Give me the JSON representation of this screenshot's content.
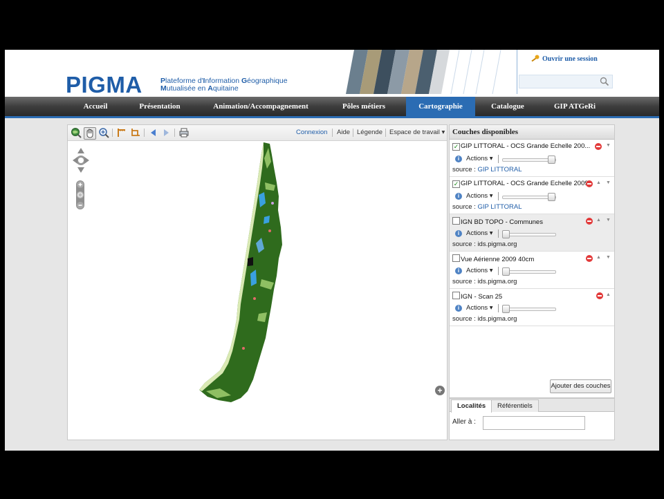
{
  "header": {
    "logo": "PIGMA",
    "tagline_line1": {
      "p": "P",
      "rest1": "lateforme d'",
      "i": "I",
      "rest2": "nformation ",
      "g": "G",
      "rest3": "éographique"
    },
    "tagline_line2": {
      "m": "M",
      "rest1": "utualisée en ",
      "a": "A",
      "rest2": "quitaine"
    },
    "session_label": "Ouvrir une session",
    "search_placeholder": ""
  },
  "nav": {
    "items": [
      {
        "label": "Accueil"
      },
      {
        "label": "Présentation"
      },
      {
        "label": "Animation/Accompagnement"
      },
      {
        "label": "Pôles métiers"
      },
      {
        "label": "Cartographie"
      },
      {
        "label": "Catalogue"
      },
      {
        "label": "GIP ATGeRi"
      }
    ],
    "active": "Cartographie"
  },
  "map_toolbar": {
    "connexion": "Connexion",
    "aide": "Aide",
    "legende": "Légende",
    "espace": "Espace de travail ▾"
  },
  "layers": {
    "title": "Couches disponibles",
    "actions_label": "Actions ▾",
    "source_prefix": "source : ",
    "items": [
      {
        "name": "GIP LITTORAL - OCS Grande Echelle 200...",
        "checked": true,
        "source": "GIP LITTORAL",
        "source_is_link": true,
        "opacity": 1.0
      },
      {
        "name": "GIP LITTORAL - OCS Grande Echelle 2009",
        "checked": true,
        "source": "GIP LITTORAL",
        "source_is_link": true,
        "opacity": 1.0
      },
      {
        "name": "IGN BD TOPO - Communes",
        "checked": false,
        "source": "ids.pigma.org",
        "source_is_link": false,
        "opacity": 0.0
      },
      {
        "name": "Vue Aérienne 2009 40cm",
        "checked": false,
        "source": "ids.pigma.org",
        "source_is_link": false,
        "opacity": 0.0
      },
      {
        "name": "IGN - Scan 25",
        "checked": false,
        "source": "ids.pigma.org",
        "source_is_link": false,
        "opacity": 0.0
      }
    ],
    "add_button": "Ajouter des couches"
  },
  "localites": {
    "tabs": [
      {
        "label": "Localités"
      },
      {
        "label": "Référentiels"
      }
    ],
    "active_tab": "Localités",
    "goto_label": "Aller à :",
    "goto_value": ""
  },
  "colors": {
    "brand_blue": "#1f5da8",
    "nav_active": "#2b6cb3",
    "forest": "#2f6b1d",
    "water": "#3aa0e0"
  }
}
